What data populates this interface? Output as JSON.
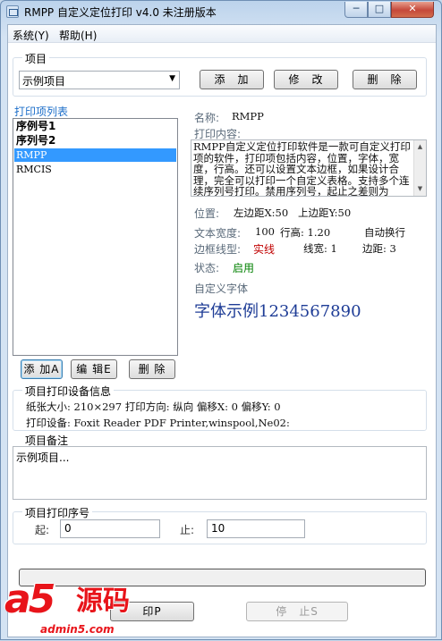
{
  "window": {
    "title": "RMPP 自定义定位打印 v4.0 未注册版本",
    "min_label": "─",
    "max_label": "□",
    "close_label": "✕"
  },
  "menu": {
    "system": "系统(Y)",
    "help": "帮助(H)"
  },
  "project_group": {
    "legend": "项目",
    "selected": "示例项目",
    "add_label": "添　加",
    "edit_label": "修　改",
    "delete_label": "删　除"
  },
  "print_list": {
    "title": "打印项列表",
    "items": [
      {
        "label": "序例号1",
        "style": "bold"
      },
      {
        "label": "序列号2",
        "style": "bold"
      },
      {
        "label": "RMPP",
        "style": "selected"
      },
      {
        "label": "RMCIS",
        "style": "small"
      }
    ],
    "add_label": "添 加A",
    "edit_label": "编 辑E",
    "delete_label": "删 除"
  },
  "details": {
    "name_label": "名称:",
    "name_value": "RMPP",
    "content_label": "打印内容:",
    "content_text": "RMPP自定义定位打印软件是一款可自定义打印项的软件，打印项包括内容，位置，字体，宽度，行高。还可以设置文本边框，如果设计合理，完全可以打印一个自定义表格。支持多个连续序列号打印。禁用序列号，起止之差则为",
    "position_label": "位置:",
    "left_margin": "左边距X:50",
    "top_margin": "上边距Y:50",
    "text_width_label": "文本宽度:",
    "text_width_value": "100",
    "line_height": "行高: 1.20",
    "auto_wrap": "自动换行",
    "border_style_label": "边框线型:",
    "border_style_value": "实线",
    "line_width": "线宽: 1",
    "padding": "边距: 3",
    "status_label": "状态:",
    "status_value": "启用",
    "custom_font_label": "自定义字体",
    "font_sample": "字体示例1234567890"
  },
  "device_group": {
    "legend": "项目打印设备信息",
    "paper_info": "纸张大小: 210×297 打印方向: 纵向 偏移X: 0 偏移Y: 0",
    "printer_info": "打印设备: Foxit Reader PDF Printer,winspool,Ne02:"
  },
  "notes_group": {
    "legend": "项目备注",
    "text": "示例项目..."
  },
  "serial_group": {
    "legend": "项目打印序号",
    "start_label": "起:",
    "start_value": "0",
    "end_label": "止:",
    "end_value": "10"
  },
  "progress": {
    "value": 0
  },
  "actions": {
    "print_label": "印P",
    "stop_label": "停　止S"
  },
  "watermark": {
    "brand": "a5",
    "brand_cn": "源码",
    "url": "admin5.com"
  },
  "colors": {
    "selected": "#3399ff",
    "border_style": "#c00000",
    "status": "#008000",
    "font_sample": "#1e3c96",
    "watermark": "#e8141a"
  }
}
